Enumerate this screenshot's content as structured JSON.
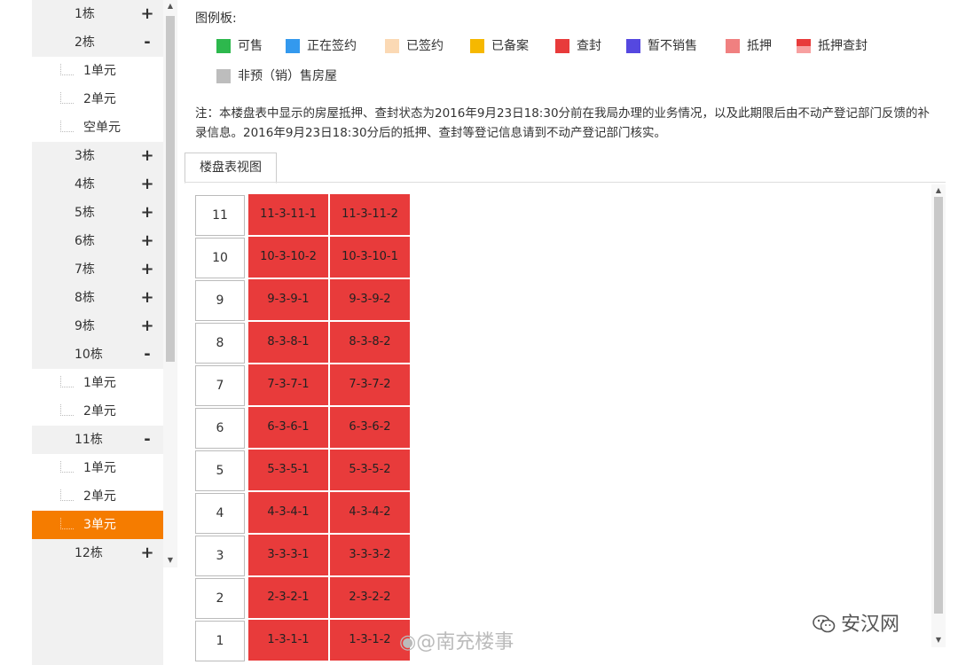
{
  "tree": {
    "items": [
      {
        "label": "1栋",
        "kind": "building",
        "toggle": "+"
      },
      {
        "label": "2栋",
        "kind": "building",
        "toggle": "-"
      },
      {
        "label": "1单元",
        "kind": "unit"
      },
      {
        "label": "2单元",
        "kind": "unit"
      },
      {
        "label": "空单元",
        "kind": "unit"
      },
      {
        "label": "3栋",
        "kind": "building",
        "toggle": "+"
      },
      {
        "label": "4栋",
        "kind": "building",
        "toggle": "+"
      },
      {
        "label": "5栋",
        "kind": "building",
        "toggle": "+"
      },
      {
        "label": "6栋",
        "kind": "building",
        "toggle": "+"
      },
      {
        "label": "7栋",
        "kind": "building",
        "toggle": "+"
      },
      {
        "label": "8栋",
        "kind": "building",
        "toggle": "+"
      },
      {
        "label": "9栋",
        "kind": "building",
        "toggle": "+"
      },
      {
        "label": "10栋",
        "kind": "building",
        "toggle": "-"
      },
      {
        "label": "1单元",
        "kind": "unit"
      },
      {
        "label": "2单元",
        "kind": "unit"
      },
      {
        "label": "11栋",
        "kind": "building",
        "toggle": "-"
      },
      {
        "label": "1单元",
        "kind": "unit"
      },
      {
        "label": "2单元",
        "kind": "unit"
      },
      {
        "label": "3单元",
        "kind": "unit",
        "selected": true
      },
      {
        "label": "12栋",
        "kind": "building",
        "toggle": "+"
      }
    ]
  },
  "legend": {
    "title": "图例板:",
    "items": [
      {
        "label": "可售",
        "color": "#2db84d"
      },
      {
        "label": "正在签约",
        "color": "#3399ee"
      },
      {
        "label": "已签约",
        "color": "#fbd9b4"
      },
      {
        "label": "已备案",
        "color": "#f6b800"
      },
      {
        "label": "查封",
        "color": "#e83b3b"
      },
      {
        "label": "暂不销售",
        "color": "#5548e0"
      },
      {
        "label": "抵押",
        "color": "#f08080"
      },
      {
        "label": "抵押查封",
        "color": "#e83b3b",
        "color2": "#f7a0a0"
      },
      {
        "label": "非预（销）售房屋",
        "color": "#bdbdbd"
      }
    ]
  },
  "note": "注：本楼盘表中显示的房屋抵押、查封状态为2016年9月23日18:30分前在我局办理的业务情况，以及此期限后由不动产登记部门反馈的补录信息。2016年9月23日18:30分后的抵押、查封等登记信息请到不动产登记部门核实。",
  "tab": {
    "label": "楼盘表视图"
  },
  "grid": {
    "room_color": "#e83b3b",
    "rows": [
      {
        "floor": "11",
        "rooms": [
          "11-3-11-1",
          "11-3-11-2"
        ]
      },
      {
        "floor": "10",
        "rooms": [
          "10-3-10-2",
          "10-3-10-1"
        ]
      },
      {
        "floor": "9",
        "rooms": [
          "9-3-9-1",
          "9-3-9-2"
        ]
      },
      {
        "floor": "8",
        "rooms": [
          "8-3-8-1",
          "8-3-8-2"
        ]
      },
      {
        "floor": "7",
        "rooms": [
          "7-3-7-1",
          "7-3-7-2"
        ]
      },
      {
        "floor": "6",
        "rooms": [
          "6-3-6-1",
          "6-3-6-2"
        ]
      },
      {
        "floor": "5",
        "rooms": [
          "5-3-5-1",
          "5-3-5-2"
        ]
      },
      {
        "floor": "4",
        "rooms": [
          "4-3-4-1",
          "4-3-4-2"
        ]
      },
      {
        "floor": "3",
        "rooms": [
          "3-3-3-1",
          "3-3-3-2"
        ]
      },
      {
        "floor": "2",
        "rooms": [
          "2-3-2-1",
          "2-3-2-2"
        ]
      },
      {
        "floor": "1",
        "rooms": [
          "1-3-1-1",
          "1-3-1-2"
        ]
      }
    ]
  },
  "watermark": {
    "weibo": "@南充楼事",
    "site": "安汉网",
    "weibo_icon": "weibo-icon",
    "site_icon": "wechat-icon"
  }
}
